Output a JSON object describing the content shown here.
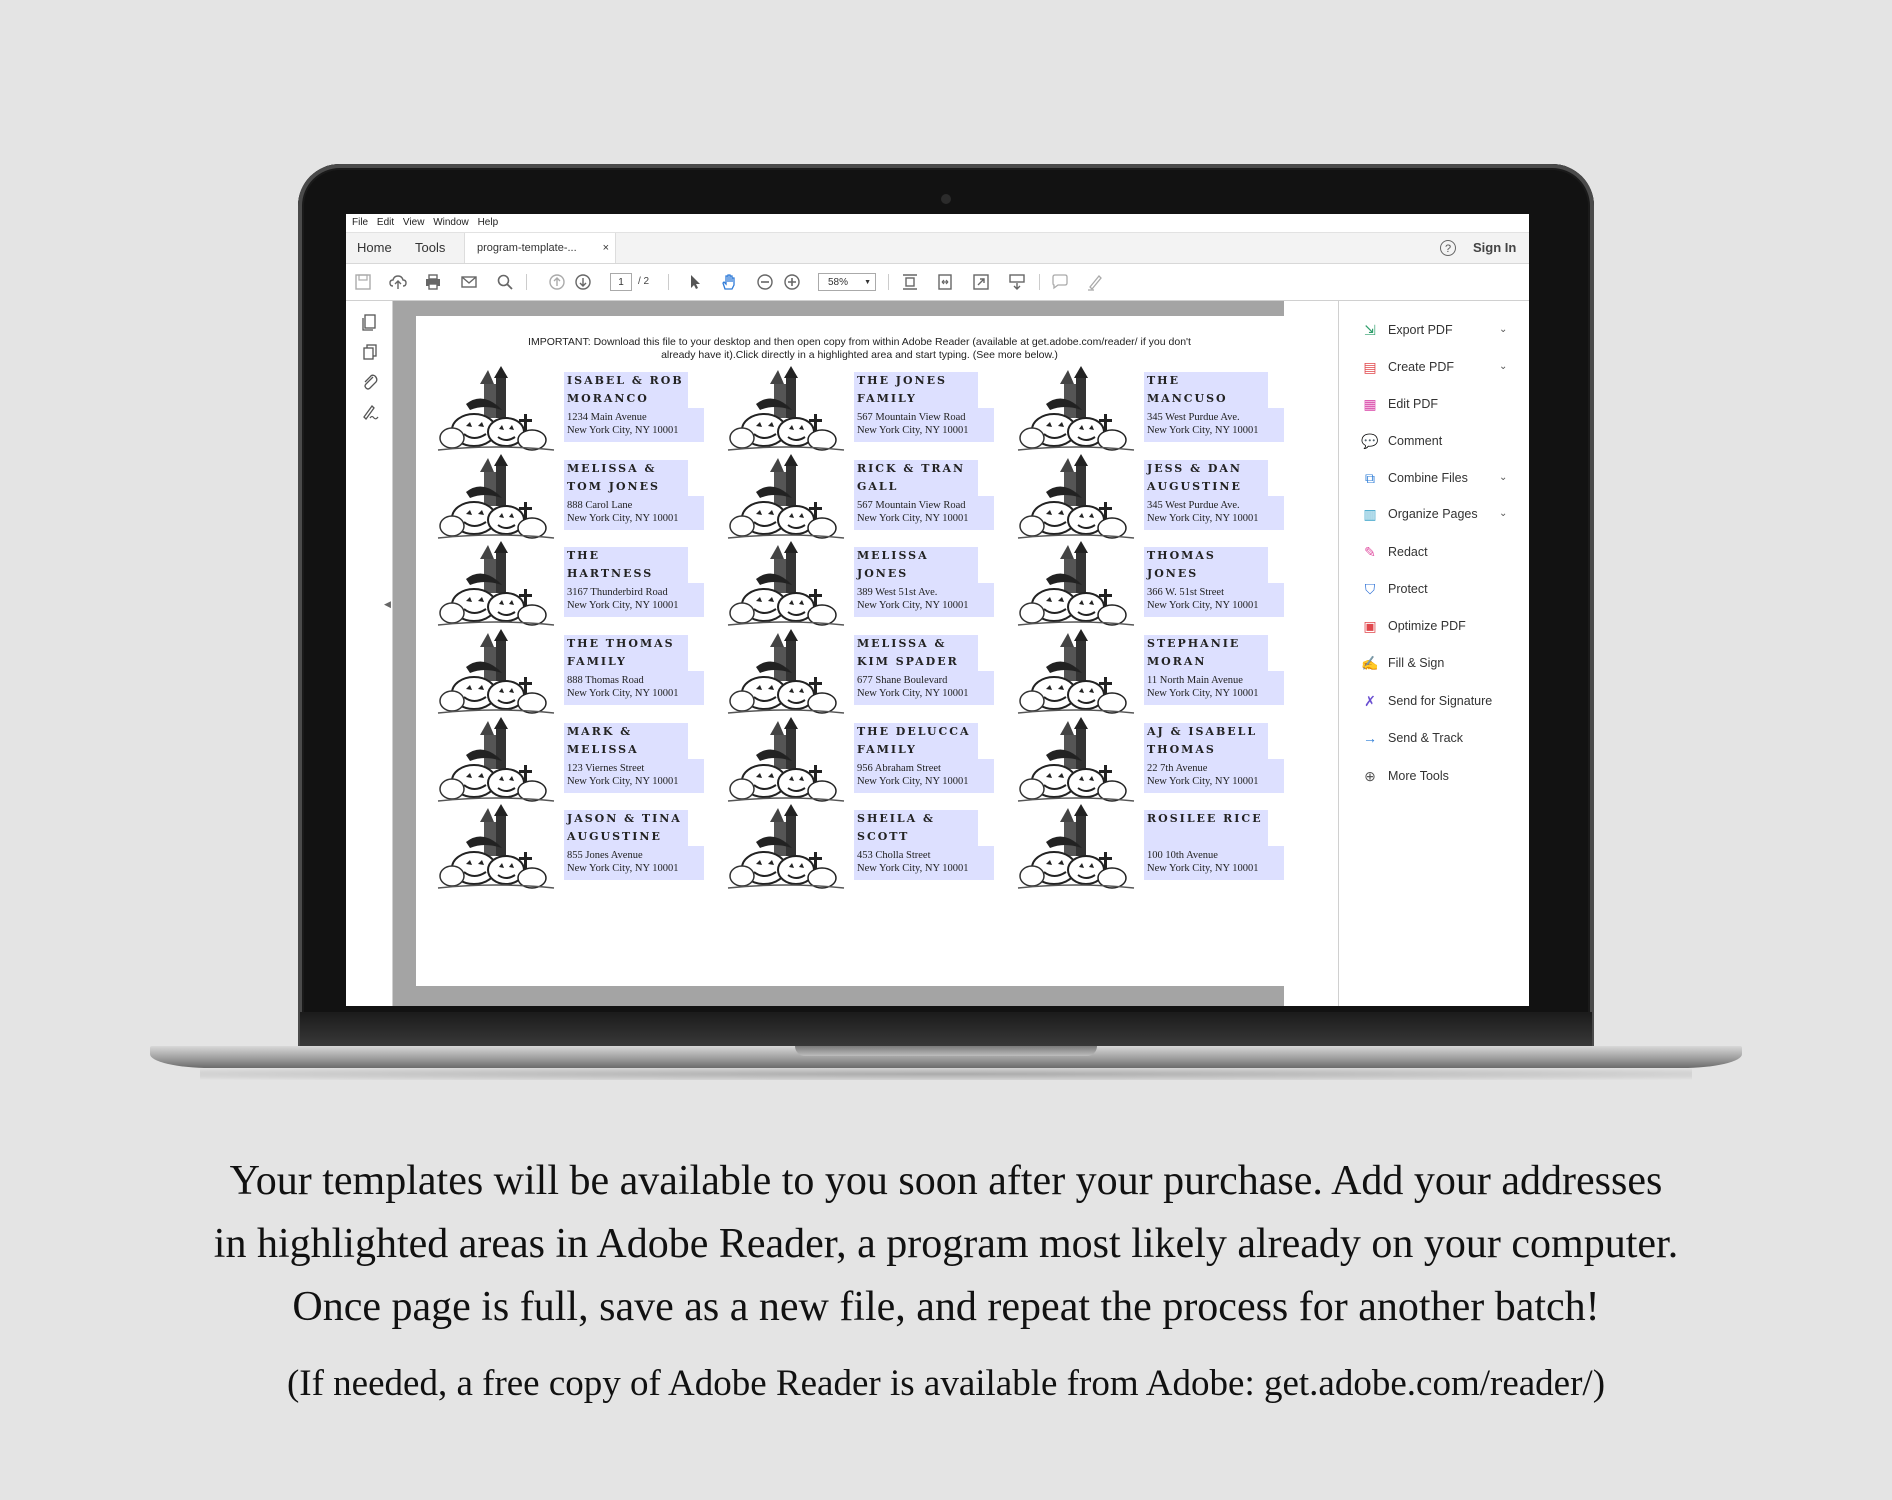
{
  "menu": [
    "File",
    "Edit",
    "View",
    "Window",
    "Help"
  ],
  "tabs": {
    "home": "Home",
    "tools": "Tools",
    "document": "program-template-...",
    "close": "×"
  },
  "header": {
    "help": "?",
    "sign_in": "Sign In"
  },
  "toolbar": {
    "page_current": "1",
    "page_total": "/ 2",
    "zoom": "58%"
  },
  "document": {
    "important_line1": "IMPORTANT: Download this file to your desktop and then open copy from within Adobe Reader (available at get.adobe.com/reader/ if you don't",
    "important_line2": "already have it).Click directly in a highlighted area and start typing. (See more below.)",
    "labels": [
      {
        "name": "ISABEL & ROB MORANCO",
        "street": "1234 Main Avenue",
        "city": "New York City, NY 10001"
      },
      {
        "name": "THE JONES FAMILY",
        "street": "567 Mountain View Road",
        "city": "New York City, NY 10001"
      },
      {
        "name": "THE MANCUSO FAMILY",
        "street": "345 West Purdue Ave.",
        "city": "New York City, NY 10001"
      },
      {
        "name": "MELISSA & TOM JONES",
        "street": "888 Carol Lane",
        "city": "New York City, NY 10001"
      },
      {
        "name": "RICK & TRAN GALL",
        "street": "567 Mountain View Road",
        "city": "New York City, NY 10001"
      },
      {
        "name": "JESS & DAN AUGUSTINE",
        "street": "345 West Purdue Ave.",
        "city": "New York City, NY 10001"
      },
      {
        "name": "THE HARTNESS FAMILY",
        "street": "3167 Thunderbird Road",
        "city": "New York City, NY 10001"
      },
      {
        "name": "MELISSA JONES",
        "street": "389 West 51st Ave.",
        "city": "New York City, NY 10001"
      },
      {
        "name": "THOMAS JONES",
        "street": "366 W. 51st Street",
        "city": "New York City, NY 10001"
      },
      {
        "name": "THE THOMAS FAMILY",
        "street": "888 Thomas Road",
        "city": "New York City, NY 10001"
      },
      {
        "name": "MELISSA & KIM SPADER",
        "street": "677 Shane Boulevard",
        "city": "New York City, NY 10001"
      },
      {
        "name": "STEPHANIE MORAN",
        "street": "11 North Main Avenue",
        "city": "New York City, NY 10001"
      },
      {
        "name": "MARK & MELISSA SCOTT",
        "street": "123 Viernes Street",
        "city": "New York City, NY 10001"
      },
      {
        "name": "THE DELUCCA FAMILY",
        "street": "956 Abraham Street",
        "city": "New York City, NY 10001"
      },
      {
        "name": "AJ & ISABELL THOMAS",
        "street": "22 7th Avenue",
        "city": "New York City, NY 10001"
      },
      {
        "name": "JASON & TINA AUGUSTINE",
        "street": "855 Jones Avenue",
        "city": "New York City, NY 10001"
      },
      {
        "name": "SHEILA & SCOTT MANCUSO",
        "street": "453 Cholla Street",
        "city": "New York City, NY 10001"
      },
      {
        "name": "ROSILEE RICE",
        "street": "100 10th Avenue",
        "city": "New York City, NY 10001"
      }
    ]
  },
  "tools_panel": [
    {
      "label": "Export PDF",
      "icon": "export-pdf-icon",
      "color": "#2e9e6b",
      "dropdown": true
    },
    {
      "label": "Create PDF",
      "icon": "create-pdf-icon",
      "color": "#e0474c",
      "dropdown": true
    },
    {
      "label": "Edit PDF",
      "icon": "edit-pdf-icon",
      "color": "#d946a8",
      "dropdown": false
    },
    {
      "label": "Comment",
      "icon": "comment-icon",
      "color": "#f2b51c",
      "dropdown": false
    },
    {
      "label": "Combine Files",
      "icon": "combine-files-icon",
      "color": "#2b7bd6",
      "dropdown": true
    },
    {
      "label": "Organize Pages",
      "icon": "organize-pages-icon",
      "color": "#3aa3c8",
      "dropdown": true
    },
    {
      "label": "Redact",
      "icon": "redact-icon",
      "color": "#e04da0",
      "dropdown": false
    },
    {
      "label": "Protect",
      "icon": "protect-icon",
      "color": "#2b6fd6",
      "dropdown": false
    },
    {
      "label": "Optimize PDF",
      "icon": "optimize-pdf-icon",
      "color": "#e0474c",
      "dropdown": false
    },
    {
      "label": "Fill & Sign",
      "icon": "fill-sign-icon",
      "color": "#7a5ad6",
      "dropdown": false
    },
    {
      "label": "Send for Signature",
      "icon": "send-for-signature-icon",
      "color": "#6a4fd1",
      "dropdown": false
    },
    {
      "label": "Send & Track",
      "icon": "send-track-icon",
      "color": "#2b7bd6",
      "dropdown": false
    },
    {
      "label": "More Tools",
      "icon": "more-tools-icon",
      "color": "#555555",
      "dropdown": false
    }
  ],
  "caption": {
    "line1": "Your templates will be available to you soon after your purchase.  Add your addresses",
    "line2": "in highlighted areas in Adobe Reader, a program most likely already on your computer.",
    "line3": "Once page is full, save as a new file, and repeat the process for another batch!",
    "note": "(If needed, a free copy of Adobe Reader is available from Adobe: get.adobe.com/reader/)"
  }
}
